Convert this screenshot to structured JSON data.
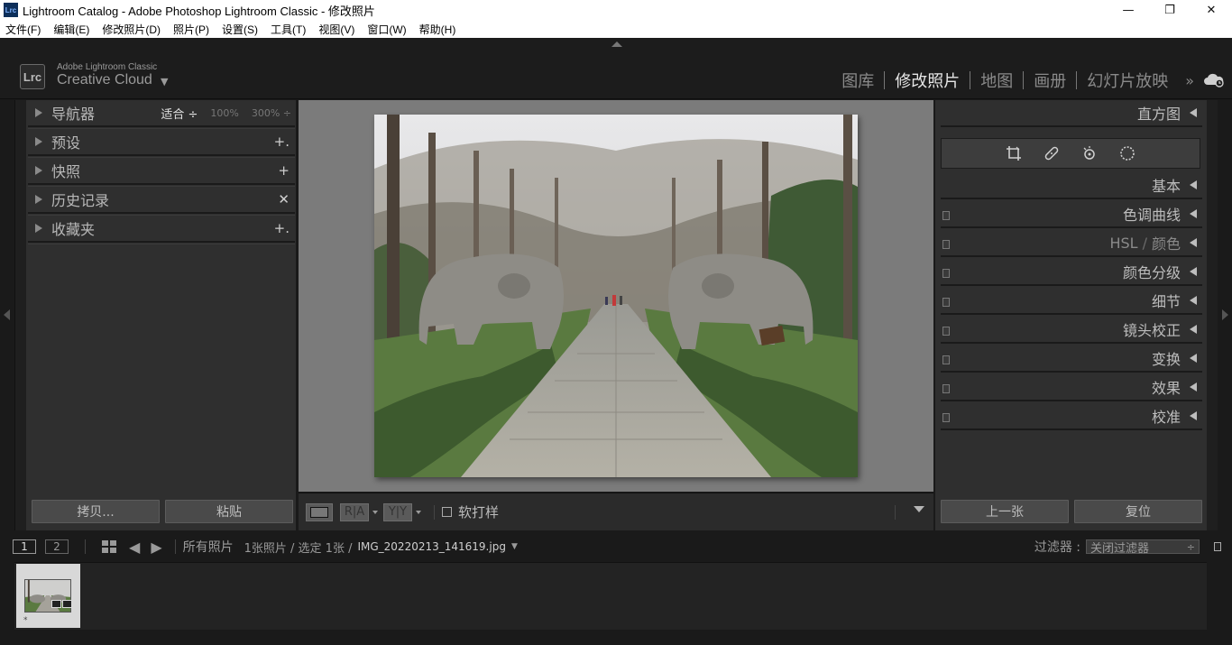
{
  "window": {
    "title": "Lightroom Catalog - Adobe Photoshop Lightroom Classic - 修改照片",
    "app_icon": "Lrc",
    "minimize": "—",
    "restore": "❐",
    "close": "✕"
  },
  "menu": {
    "items": [
      "文件(F)",
      "编辑(E)",
      "修改照片(D)",
      "照片(P)",
      "设置(S)",
      "工具(T)",
      "视图(V)",
      "窗口(W)",
      "帮助(H)"
    ]
  },
  "identity": {
    "logo": "Lrc",
    "brand_small": "Adobe Lightroom Classic",
    "brand_big": "Creative Cloud",
    "caret": "▼"
  },
  "modules": {
    "items": [
      "图库",
      "修改照片",
      "地图",
      "画册",
      "幻灯片放映"
    ],
    "active_index": 1,
    "more": "»"
  },
  "left_panel": {
    "navigator": {
      "label": "导航器",
      "fit": "适合 ÷",
      "z100": "100%",
      "z300": "300% ÷"
    },
    "presets": {
      "label": "预设",
      "action": "+."
    },
    "snapshots": {
      "label": "快照",
      "action": "+"
    },
    "history": {
      "label": "历史记录",
      "action": "✕"
    },
    "collections": {
      "label": "收藏夹",
      "action": "+."
    },
    "copy_button": "拷贝...",
    "paste_button": "粘贴"
  },
  "toolbar": {
    "ra": "R|A",
    "yy": "Y|Y",
    "softproof": "软打样"
  },
  "right_panel": {
    "histogram": "直方图",
    "sections": [
      {
        "label": "基本",
        "switch": false
      },
      {
        "label": "色调曲线",
        "switch": true
      },
      {
        "label": "HSL",
        "sep": "/",
        "label2": "颜色",
        "switch": true,
        "dim": true
      },
      {
        "label": "颜色分级",
        "switch": true
      },
      {
        "label": "细节",
        "switch": true
      },
      {
        "label": "镜头校正",
        "switch": true
      },
      {
        "label": "变换",
        "switch": true
      },
      {
        "label": "效果",
        "switch": true
      },
      {
        "label": "校准",
        "switch": true
      }
    ],
    "prev_button": "上一张",
    "reset_button": "复位"
  },
  "filmstrip_bar": {
    "view1": "1",
    "view2": "2",
    "source": "所有照片",
    "count": "1张照片 / 选定 1张 /",
    "filename": "IMG_20220213_141619.jpg",
    "filename_caret": "▼",
    "filter_label": "过滤器 :",
    "filter_value": "关闭过滤器",
    "filter_spin": "÷"
  },
  "thumb": {
    "marker": "*"
  }
}
